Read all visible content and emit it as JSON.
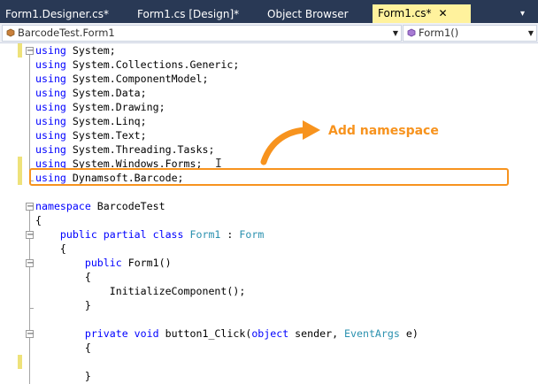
{
  "tabs": [
    {
      "label": "Form1.Designer.cs*",
      "active": false
    },
    {
      "label": "Form1.cs [Design]*",
      "active": false
    },
    {
      "label": "Object Browser",
      "active": false
    },
    {
      "label": "Form1.cs*",
      "active": true,
      "close_glyph": "✕",
      "pin_glyph": "▾"
    }
  ],
  "nav": {
    "class_combo": "BarcodeTest.Form1",
    "member_combo": "Form1()",
    "dropdown_glyph": "▼"
  },
  "code_lines": [
    [
      {
        "t": "using",
        "c": "kw"
      },
      {
        "t": " System;"
      }
    ],
    [
      {
        "t": "using",
        "c": "kw"
      },
      {
        "t": " System.Collections.Generic;"
      }
    ],
    [
      {
        "t": "using",
        "c": "kw"
      },
      {
        "t": " System.ComponentModel;"
      }
    ],
    [
      {
        "t": "using",
        "c": "kw"
      },
      {
        "t": " System.Data;"
      }
    ],
    [
      {
        "t": "using",
        "c": "kw"
      },
      {
        "t": " System.Drawing;"
      }
    ],
    [
      {
        "t": "using",
        "c": "kw"
      },
      {
        "t": " System.Linq;"
      }
    ],
    [
      {
        "t": "using",
        "c": "kw"
      },
      {
        "t": " System.Text;"
      }
    ],
    [
      {
        "t": "using",
        "c": "kw"
      },
      {
        "t": " System.Threading.Tasks;"
      }
    ],
    [
      {
        "t": "using",
        "c": "kw"
      },
      {
        "t": " System.Windows.Forms;"
      }
    ],
    [
      {
        "t": "using",
        "c": "kw"
      },
      {
        "t": " Dynamsoft.Barcode;"
      }
    ],
    [],
    [
      {
        "t": "namespace",
        "c": "kw"
      },
      {
        "t": " BarcodeTest"
      }
    ],
    [
      {
        "t": "{"
      }
    ],
    [
      {
        "t": "    "
      },
      {
        "t": "public partial class",
        "c": "kw"
      },
      {
        "t": " "
      },
      {
        "t": "Form1",
        "c": "ty"
      },
      {
        "t": " : "
      },
      {
        "t": "Form",
        "c": "ty"
      }
    ],
    [
      {
        "t": "    {"
      }
    ],
    [
      {
        "t": "        "
      },
      {
        "t": "public",
        "c": "kw"
      },
      {
        "t": " Form1()"
      }
    ],
    [
      {
        "t": "        {"
      }
    ],
    [
      {
        "t": "            InitializeComponent();"
      }
    ],
    [
      {
        "t": "        }"
      }
    ],
    [],
    [
      {
        "t": "        "
      },
      {
        "t": "private void",
        "c": "kw"
      },
      {
        "t": " button1_Click("
      },
      {
        "t": "object",
        "c": "kw"
      },
      {
        "t": " sender, "
      },
      {
        "t": "EventArgs",
        "c": "ty"
      },
      {
        "t": " e)"
      }
    ],
    [
      {
        "t": "        {"
      }
    ],
    [],
    [
      {
        "t": "        }"
      }
    ]
  ],
  "annotation": {
    "label": "Add namespace",
    "color": "#f7931e"
  },
  "text_cursor_glyph": "I",
  "colors": {
    "tab_bar": "#293955",
    "active_tab": "#fff29d",
    "keyword": "#0000ff",
    "type": "#2b91af",
    "change_bar": "#eee27a"
  }
}
